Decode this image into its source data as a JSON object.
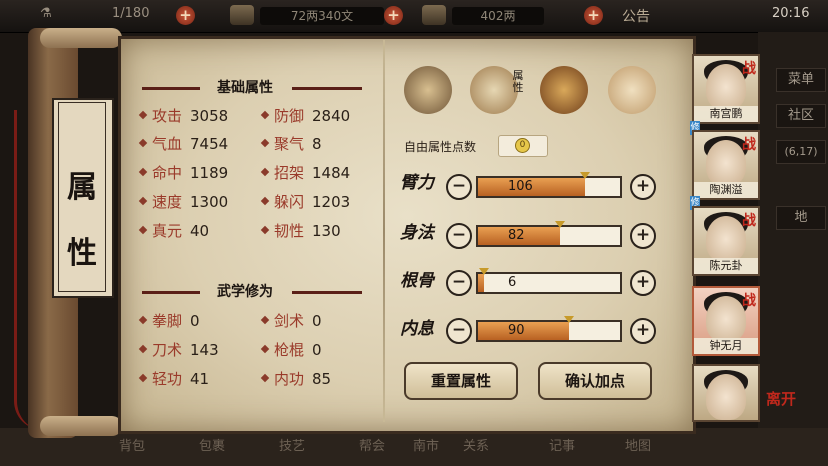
{
  "topbar": {
    "stamina": "1/180",
    "copper": "72两340文",
    "silver": "402两",
    "notice": "公告",
    "time": "20:16"
  },
  "side_tabs": [
    "菜单",
    "社区",
    "(6,17)",
    "地"
  ],
  "bottom_bar": [
    "背包",
    "包裹",
    "技艺",
    "帮会",
    "南市",
    "关系",
    "记事",
    "地图"
  ],
  "scroll": {
    "title": "属性"
  },
  "tab_label": "属性",
  "basic": {
    "title": "基础属性",
    "stats": [
      {
        "label": "攻击",
        "value": "3058"
      },
      {
        "label": "防御",
        "value": "2840"
      },
      {
        "label": "气血",
        "value": "7454"
      },
      {
        "label": "聚气",
        "value": "8"
      },
      {
        "label": "命中",
        "value": "1189"
      },
      {
        "label": "招架",
        "value": "1484"
      },
      {
        "label": "速度",
        "value": "1300"
      },
      {
        "label": "躲闪",
        "value": "1203"
      },
      {
        "label": "真元",
        "value": "40"
      },
      {
        "label": "韧性",
        "value": "130"
      }
    ]
  },
  "martial": {
    "title": "武学修为",
    "stats": [
      {
        "label": "拳脚",
        "value": "0"
      },
      {
        "label": "剑术",
        "value": "0"
      },
      {
        "label": "刀术",
        "value": "143"
      },
      {
        "label": "枪棍",
        "value": "0"
      },
      {
        "label": "轻功",
        "value": "41"
      },
      {
        "label": "内功",
        "value": "85"
      }
    ]
  },
  "free_points": {
    "label": "自由属性点数",
    "value": "0"
  },
  "attributes": [
    {
      "name": "臂力",
      "value": "106",
      "fill": 0.75
    },
    {
      "name": "身法",
      "value": "82",
      "fill": 0.58
    },
    {
      "name": "根骨",
      "value": "6",
      "fill": 0.04
    },
    {
      "name": "内息",
      "value": "90",
      "fill": 0.64
    }
  ],
  "buttons": {
    "reset": "重置属性",
    "confirm": "确认加点"
  },
  "characters": [
    {
      "name": "南宫鹏",
      "battle": "战",
      "cultivating": "修"
    },
    {
      "name": "陶渊溢",
      "battle": "战",
      "cultivating": "修"
    },
    {
      "name": "陈元卦",
      "battle": "战"
    },
    {
      "name": "钟无月",
      "battle": "战"
    },
    {
      "name": ""
    }
  ],
  "leave": "离开"
}
